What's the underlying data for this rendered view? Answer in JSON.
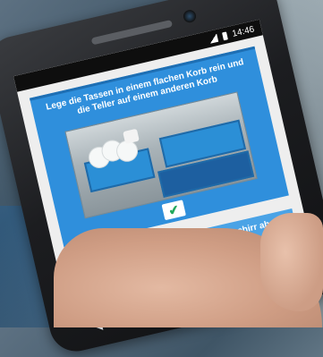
{
  "status_bar": {
    "time": "14:46"
  },
  "instructions": [
    {
      "text": "Lege die Tassen in einem flachen Korb rein und die Teller auf einem anderen Korb",
      "button_icon": "check-icon"
    },
    {
      "text": "Spüle mit der Brause kurz das Geschirr ab",
      "button_icon": "check-icon"
    }
  ],
  "colors": {
    "card": "#2f8fdc",
    "card_secondary": "#4aa3e6",
    "check": "#23a85c"
  }
}
